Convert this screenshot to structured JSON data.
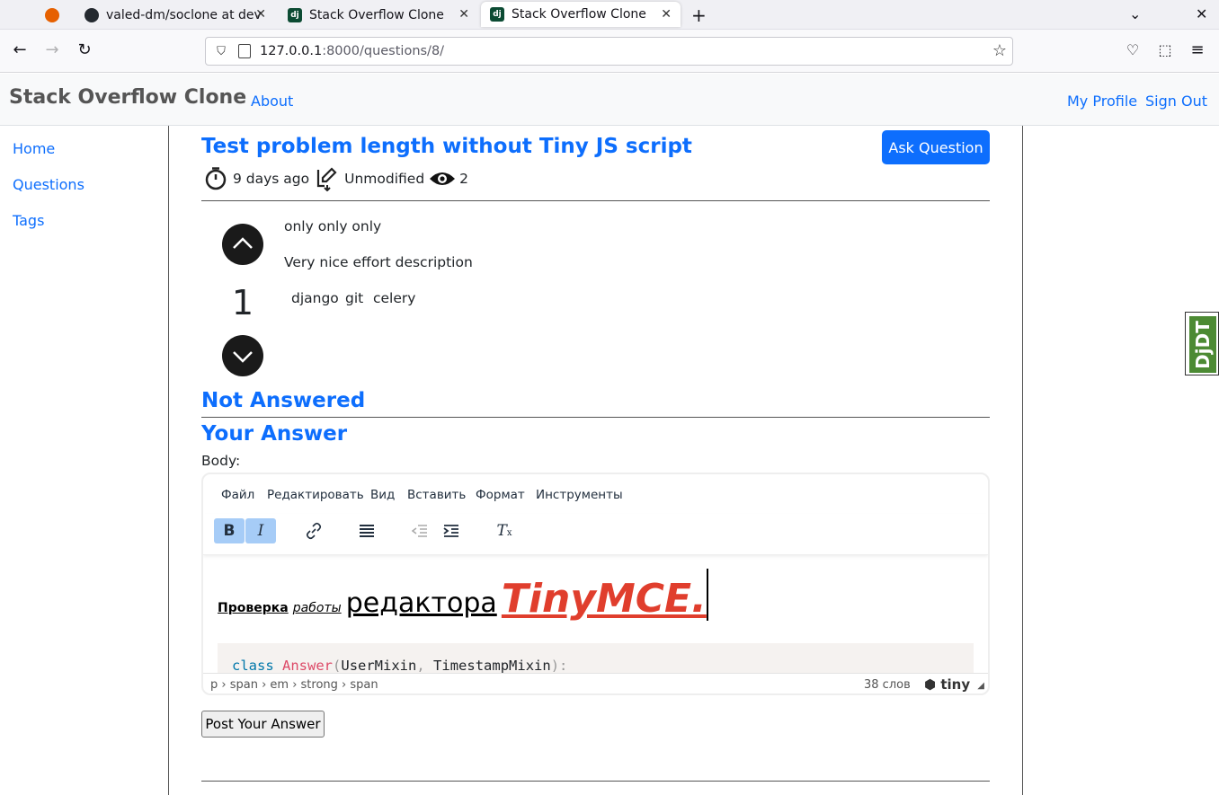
{
  "browser": {
    "tabs": [
      {
        "title": "valed-dm/soclone at dev",
        "icon": "github-icon"
      },
      {
        "title": "Stack Overflow Clone",
        "icon": "django-icon"
      },
      {
        "title": "Stack Overflow Clone",
        "icon": "django-icon",
        "active": true
      }
    ],
    "url_host": "127.0.0.1",
    "url_path": ":8000/questions/8/"
  },
  "header": {
    "brand": "Stack Overflow Clone",
    "about": "About",
    "my_profile": "My Profile",
    "sign_out": "Sign Out"
  },
  "sidebar": {
    "items": [
      {
        "label": "Home"
      },
      {
        "label": "Questions"
      },
      {
        "label": "Tags"
      }
    ]
  },
  "question": {
    "title": "Test problem length without Tiny JS script",
    "ask_button": "Ask Question",
    "created": "9 days ago",
    "modified": "Unmodified",
    "views": "2",
    "votes": "1",
    "body_lines": [
      "only only only",
      "Very nice effort description"
    ],
    "tags": [
      "django",
      "git",
      "celery"
    ]
  },
  "answers": {
    "status": "Not Answered",
    "your_answer": "Your Answer",
    "body_label": "Body:"
  },
  "editor": {
    "menu": [
      "Файл",
      "Редактировать",
      "Вид",
      "Вставить",
      "Формат",
      "Инструменты"
    ],
    "content": {
      "strong": "Проверка",
      "em": "работы",
      "big": "редактора",
      "red": "TinyMCE."
    },
    "code": {
      "kw": "class",
      "cls": "Answer",
      "open": "(",
      "args": "UserMixin",
      "comma": ",",
      "args2": "TimestampMixin",
      "close": "):"
    },
    "path": "p › span › em › strong › span",
    "word_count": "38 слов",
    "logo": "tiny",
    "accent_red": "#e03e2d"
  },
  "post_button": "Post Your Answer",
  "djdt_label": "DjDT",
  "colors": {
    "link": "#0d6efd",
    "vote_button": "#1a1a1a"
  }
}
